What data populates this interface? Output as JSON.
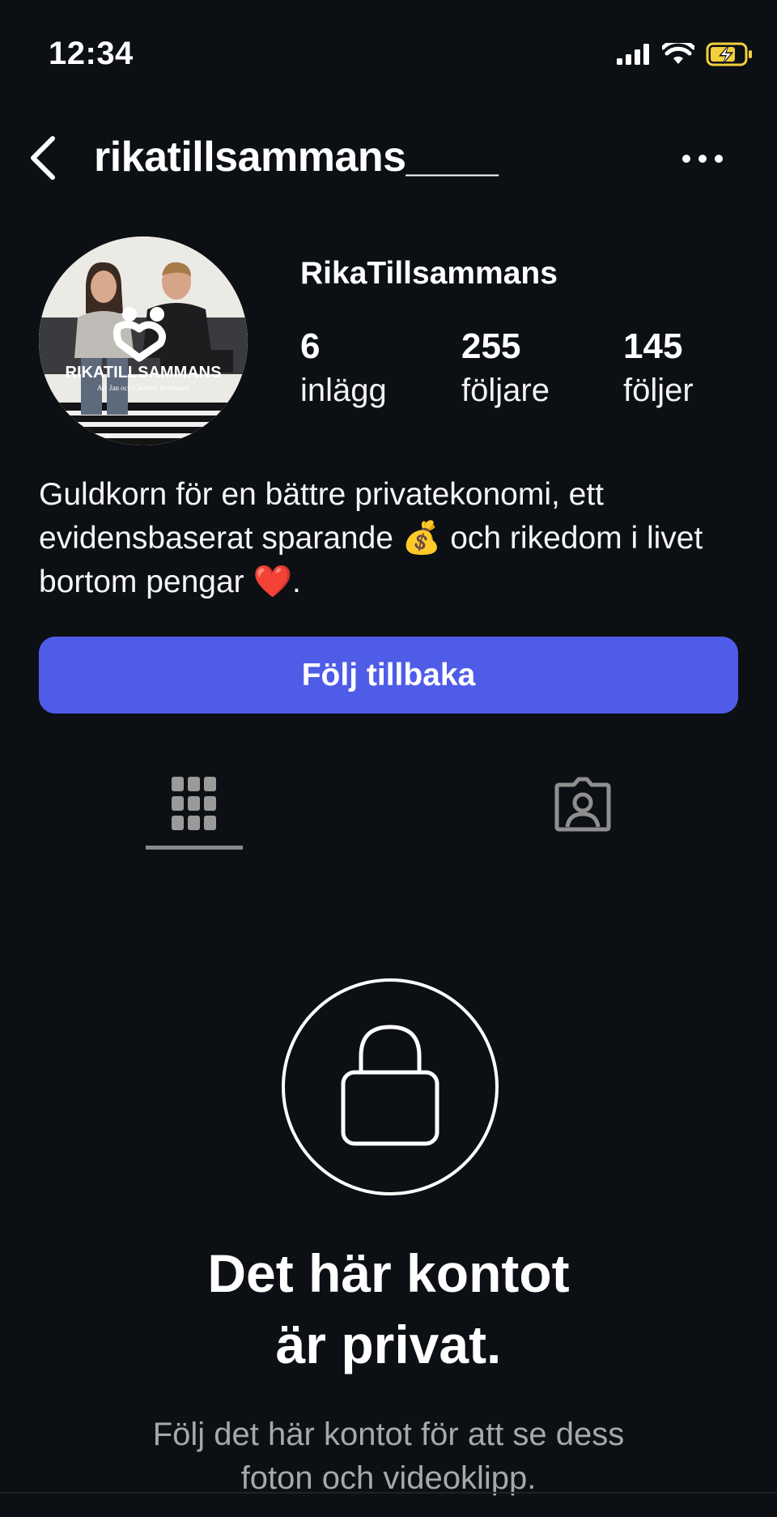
{
  "status_bar": {
    "time": "12:34",
    "icons": [
      "signal-icon",
      "wifi-icon",
      "battery-charging-icon"
    ],
    "battery_color": "#f2cf3c"
  },
  "header": {
    "username": "rikatillsammans____",
    "back_icon": "chevron-left-icon",
    "more_icon": "more-horizontal-icon"
  },
  "profile": {
    "display_name": "RikaTillsammans",
    "avatar_brand": "RIKATILLSAMMANS",
    "avatar_caption": "Av: Jan och Caroline Bolmeson",
    "stats": [
      {
        "value": "6",
        "label": "inlägg"
      },
      {
        "value": "255",
        "label": "följare"
      },
      {
        "value": "145",
        "label": "följer"
      }
    ],
    "bio": "Guldkorn för en bättre privatekonomi, ett evidensbaserat sparande 💰 och rikedom i livet bortom pengar ❤️."
  },
  "actions": {
    "follow_label": "Följ tillbaka",
    "follow_color": "#4f5ce8"
  },
  "tabs": [
    {
      "name": "grid",
      "icon": "grid-icon",
      "active": true
    },
    {
      "name": "tagged",
      "icon": "tagged-person-icon",
      "active": false
    }
  ],
  "private": {
    "icon": "lock-icon",
    "title": "Det här kontot\när privat.",
    "subtitle": "Följ det här kontot för att se dess\nfoton och videoklipp."
  }
}
